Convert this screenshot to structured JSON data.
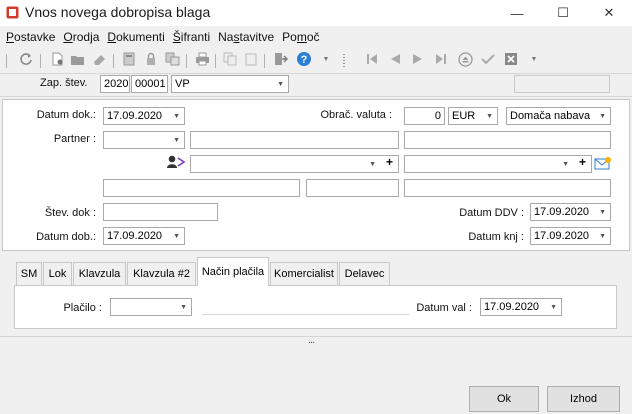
{
  "window": {
    "title": "Vnos novega dobropisa blaga",
    "minimize": "—",
    "maximize": "☐",
    "close": "✕"
  },
  "menu": {
    "items": [
      {
        "pre": "",
        "u": "P",
        "post": "ostavke"
      },
      {
        "pre": "",
        "u": "O",
        "post": "rodja"
      },
      {
        "pre": "",
        "u": "D",
        "post": "okumenti"
      },
      {
        "pre": "",
        "u": "Š",
        "post": "ifranti"
      },
      {
        "pre": "Na",
        "u": "s",
        "post": "tavitve"
      },
      {
        "pre": "Po",
        "u": "m",
        "post": "oč"
      }
    ]
  },
  "header": {
    "zap_label": "Zap. štev.",
    "year": "2020",
    "number": "00001",
    "doc_type": "VP"
  },
  "form": {
    "datum_dok_label": "Datum dok.:",
    "datum_dok": "17.09.2020",
    "obrac_valuta_label": "Obrač. valuta :",
    "rate": "0",
    "currency": "EUR",
    "nabava": "Domača nabava",
    "partner_label": "Partner :",
    "stev_dok_label": "Štev. dok :",
    "datum_ddv_label": "Datum DDV :",
    "datum_ddv": "17.09.2020",
    "datum_dob_label": "Datum dob.:",
    "datum_dob": "17.09.2020",
    "datum_knj_label": "Datum knj :",
    "datum_knj": "17.09.2020"
  },
  "tabs": [
    "SM",
    "Lok",
    "Klavzula",
    "Klavzula #2",
    "Način plačila",
    "Komercialist",
    "Delavec"
  ],
  "tab_content": {
    "placilo_label": "Plačilo :",
    "datum_val_label": "Datum val :",
    "datum_val": "17.09.2020"
  },
  "splitter": "...",
  "buttons": {
    "ok": "Ok",
    "exit": "Izhod"
  },
  "colors": {
    "accent": "#2b7fd4",
    "icon_red": "#d13b2b"
  }
}
